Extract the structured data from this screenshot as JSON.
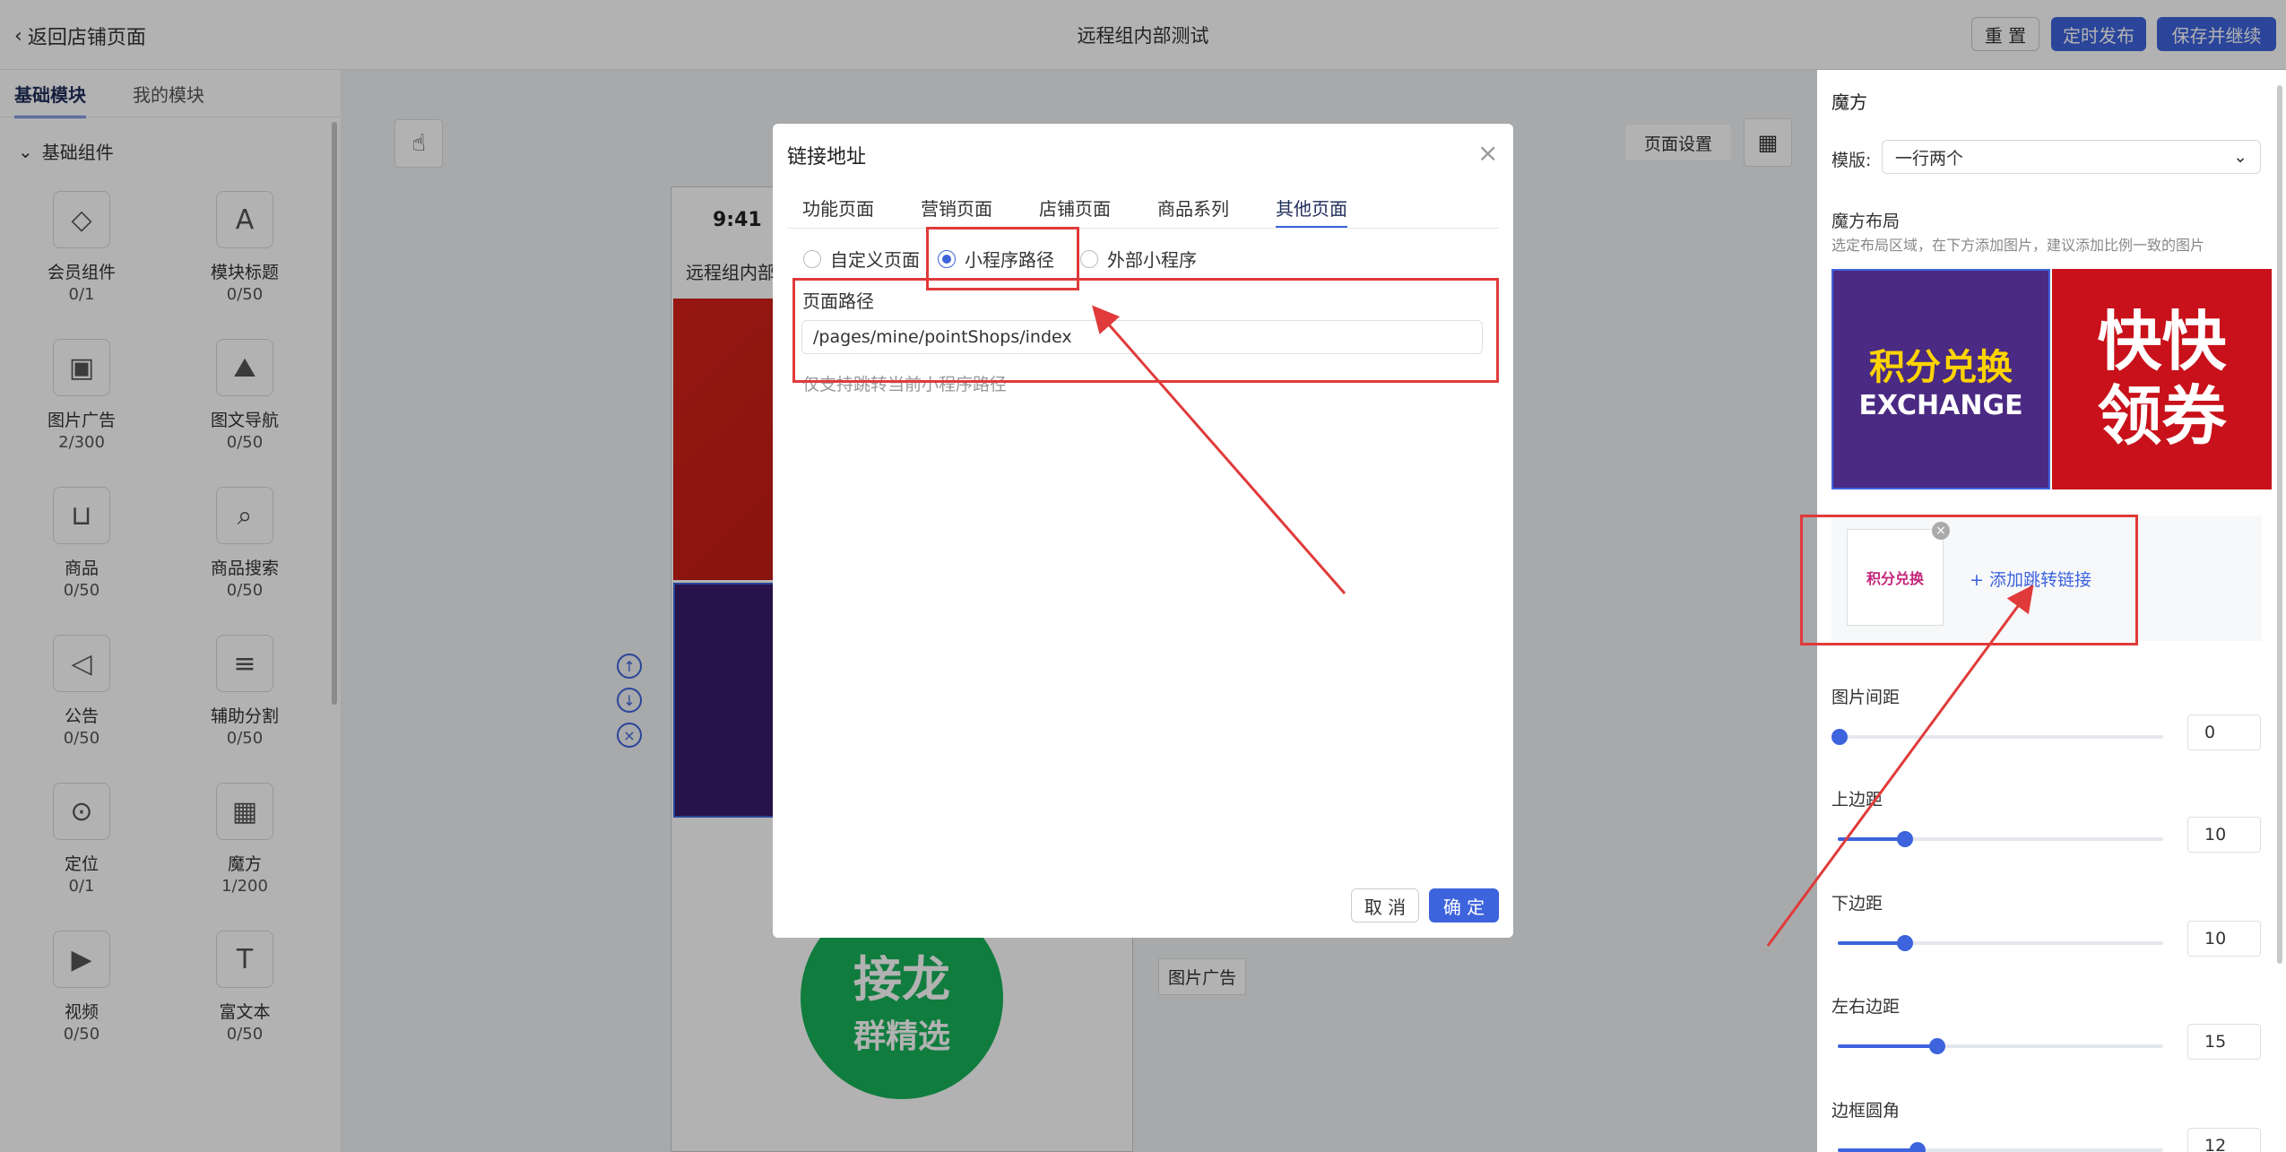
{
  "topbar": {
    "back_label": "返回店铺页面",
    "title": "远程组内部测试",
    "reset_label": "重 置",
    "schedule_label": "定时发布",
    "save_label": "保存并继续"
  },
  "left": {
    "tabs": [
      "基础模块",
      "我的模块"
    ],
    "group_title": "基础组件",
    "components": [
      {
        "name": "会员组件",
        "count": "0/1",
        "icon": "diamond-icon"
      },
      {
        "name": "模块标题",
        "count": "0/50",
        "icon": "text-a-icon"
      },
      {
        "name": "图片广告",
        "count": "2/300",
        "icon": "image-icon"
      },
      {
        "name": "图文导航",
        "count": "0/50",
        "icon": "mountain-image-icon"
      },
      {
        "name": "商品",
        "count": "0/50",
        "icon": "shopping-bag-icon"
      },
      {
        "name": "商品搜索",
        "count": "0/50",
        "icon": "search-icon"
      },
      {
        "name": "公告",
        "count": "0/50",
        "icon": "speaker-icon"
      },
      {
        "name": "辅助分割",
        "count": "0/50",
        "icon": "divider-icon"
      },
      {
        "name": "定位",
        "count": "0/1",
        "icon": "location-pin-icon"
      },
      {
        "name": "魔方",
        "count": "1/200",
        "icon": "grid-layout-icon"
      },
      {
        "name": "视频",
        "count": "0/50",
        "icon": "video-icon"
      },
      {
        "name": "富文本",
        "count": "0/50",
        "icon": "text-t-icon"
      }
    ]
  },
  "canvas": {
    "page_settings_label": "页面设置",
    "phone_time": "9:41",
    "shop_name": "远程组内部",
    "image_ad_label": "图片广告",
    "circle_line1": "接龙",
    "circle_line2": "群精选"
  },
  "modal": {
    "title": "链接地址",
    "tabs": [
      "功能页面",
      "营销页面",
      "店铺页面",
      "商品系列",
      "其他页面"
    ],
    "active_tab": "其他页面",
    "radios": [
      "自定义页面",
      "小程序路径",
      "外部小程序"
    ],
    "selected_radio": "小程序路径",
    "path_label": "页面路径",
    "path_value": "/pages/mine/pointShops/index",
    "hint": "仅支持跳转当前小程序路径",
    "cancel_label": "取 消",
    "ok_label": "确 定"
  },
  "right": {
    "title": "魔方",
    "template_label": "模版:",
    "template_value": "一行两个",
    "layout_title": "魔方布局",
    "layout_sub": "选定布局区域，在下方添加图片，建议添加比例一致的图片",
    "cube1_line1": "积分兑换",
    "cube1_line2": "EXCHANGE",
    "cube2_line1": "快快",
    "cube2_line2": "领券",
    "thumb_text": "积分兑换",
    "add_link_label": "+ 添加跳转链接",
    "sliders": [
      {
        "label": "图片间距",
        "value": "0",
        "fraction": 0
      },
      {
        "label": "上边距",
        "value": "10",
        "fraction": 0.2
      },
      {
        "label": "下边距",
        "value": "10",
        "fraction": 0.2
      },
      {
        "label": "左右边距",
        "value": "15",
        "fraction": 0.3
      },
      {
        "label": "边框圆角",
        "value": "12",
        "fraction": 0.24
      }
    ]
  },
  "colors": {
    "accent": "#3d63dd",
    "annotation_red": "#e03a3a"
  }
}
